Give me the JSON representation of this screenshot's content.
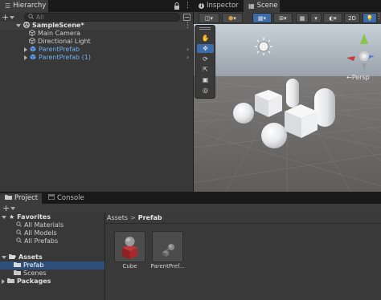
{
  "hierarchy": {
    "tab_label": "Hierarchy",
    "search_placeholder": "All",
    "scene_name": "SampleScene*",
    "items": [
      {
        "label": "Main Camera"
      },
      {
        "label": "Directional Light"
      },
      {
        "label": "ParentPrefab"
      },
      {
        "label": "ParentPrefab (1)"
      }
    ]
  },
  "top_tabs": {
    "inspector": "Inspector",
    "scene": "Scene"
  },
  "scene_toolbar": {
    "two_d": "2D"
  },
  "scene_view": {
    "camera_label": "←Persp",
    "gizmo_y": "y",
    "gizmo_x": "x",
    "gizmo_z": "z"
  },
  "bottom_tabs": {
    "project": "Project",
    "console": "Console"
  },
  "project": {
    "favorites_label": "Favorites",
    "favorites": [
      {
        "label": "All Materials"
      },
      {
        "label": "All Models"
      },
      {
        "label": "All Prefabs"
      }
    ],
    "assets_label": "Assets",
    "assets_children": [
      {
        "label": "Prefab"
      },
      {
        "label": "Scenes"
      }
    ],
    "packages_label": "Packages",
    "breadcrumb_root": "Assets",
    "breadcrumb_sep": ">",
    "breadcrumb_current": "Prefab",
    "asset_items": [
      {
        "label": "Cube"
      },
      {
        "label": "ParentPref..."
      }
    ]
  },
  "colors": {
    "accent_blue": "#3d7dc9",
    "selection": "#2d4f7a",
    "prefab_blue": "#5ea3e8",
    "sky": "#b9c3cc",
    "ground": "#6c6c6c",
    "cube_red": "#a8282c"
  }
}
